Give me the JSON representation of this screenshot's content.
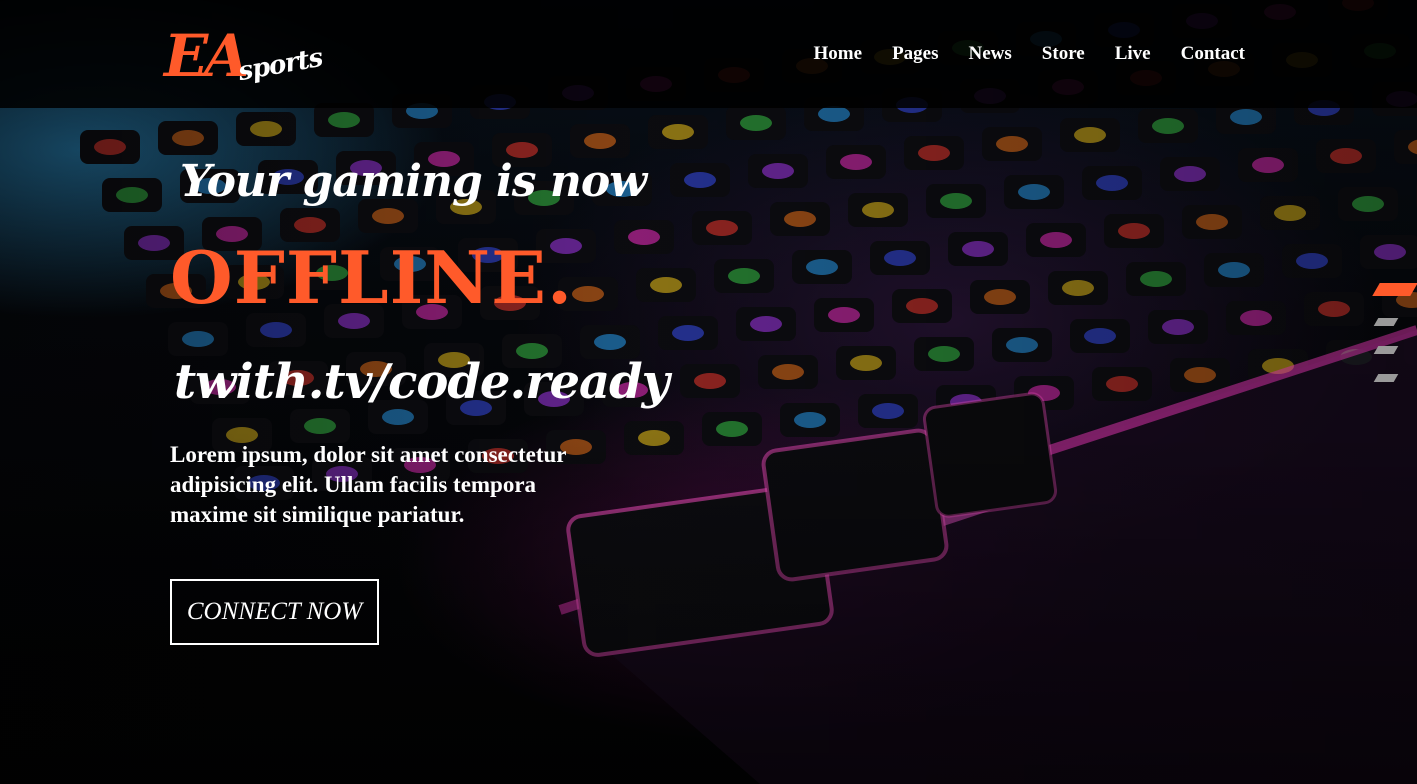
{
  "logo": {
    "primary": "EA",
    "secondary": "sports"
  },
  "nav": {
    "items": [
      "Home",
      "Pages",
      "News",
      "Store",
      "Live",
      "Contact"
    ]
  },
  "hero": {
    "tagline": "Your gaming is now",
    "headline": "OFFLINE.",
    "handle": "twith.tv/code.ready",
    "description": "Lorem ipsum, dolor sit amet consectetur adipisicing elit. Ullam facilis tempora maxime sit similique pariatur.",
    "cta_label": "CONNECT NOW"
  },
  "slider": {
    "total": 4,
    "active": 1
  },
  "colors": {
    "accent": "#ff5a2a",
    "header_bg": "#000000",
    "text": "#ffffff",
    "indicator_idle": "#9a9a9a"
  },
  "icons": [
    "keyboard-background-image"
  ]
}
